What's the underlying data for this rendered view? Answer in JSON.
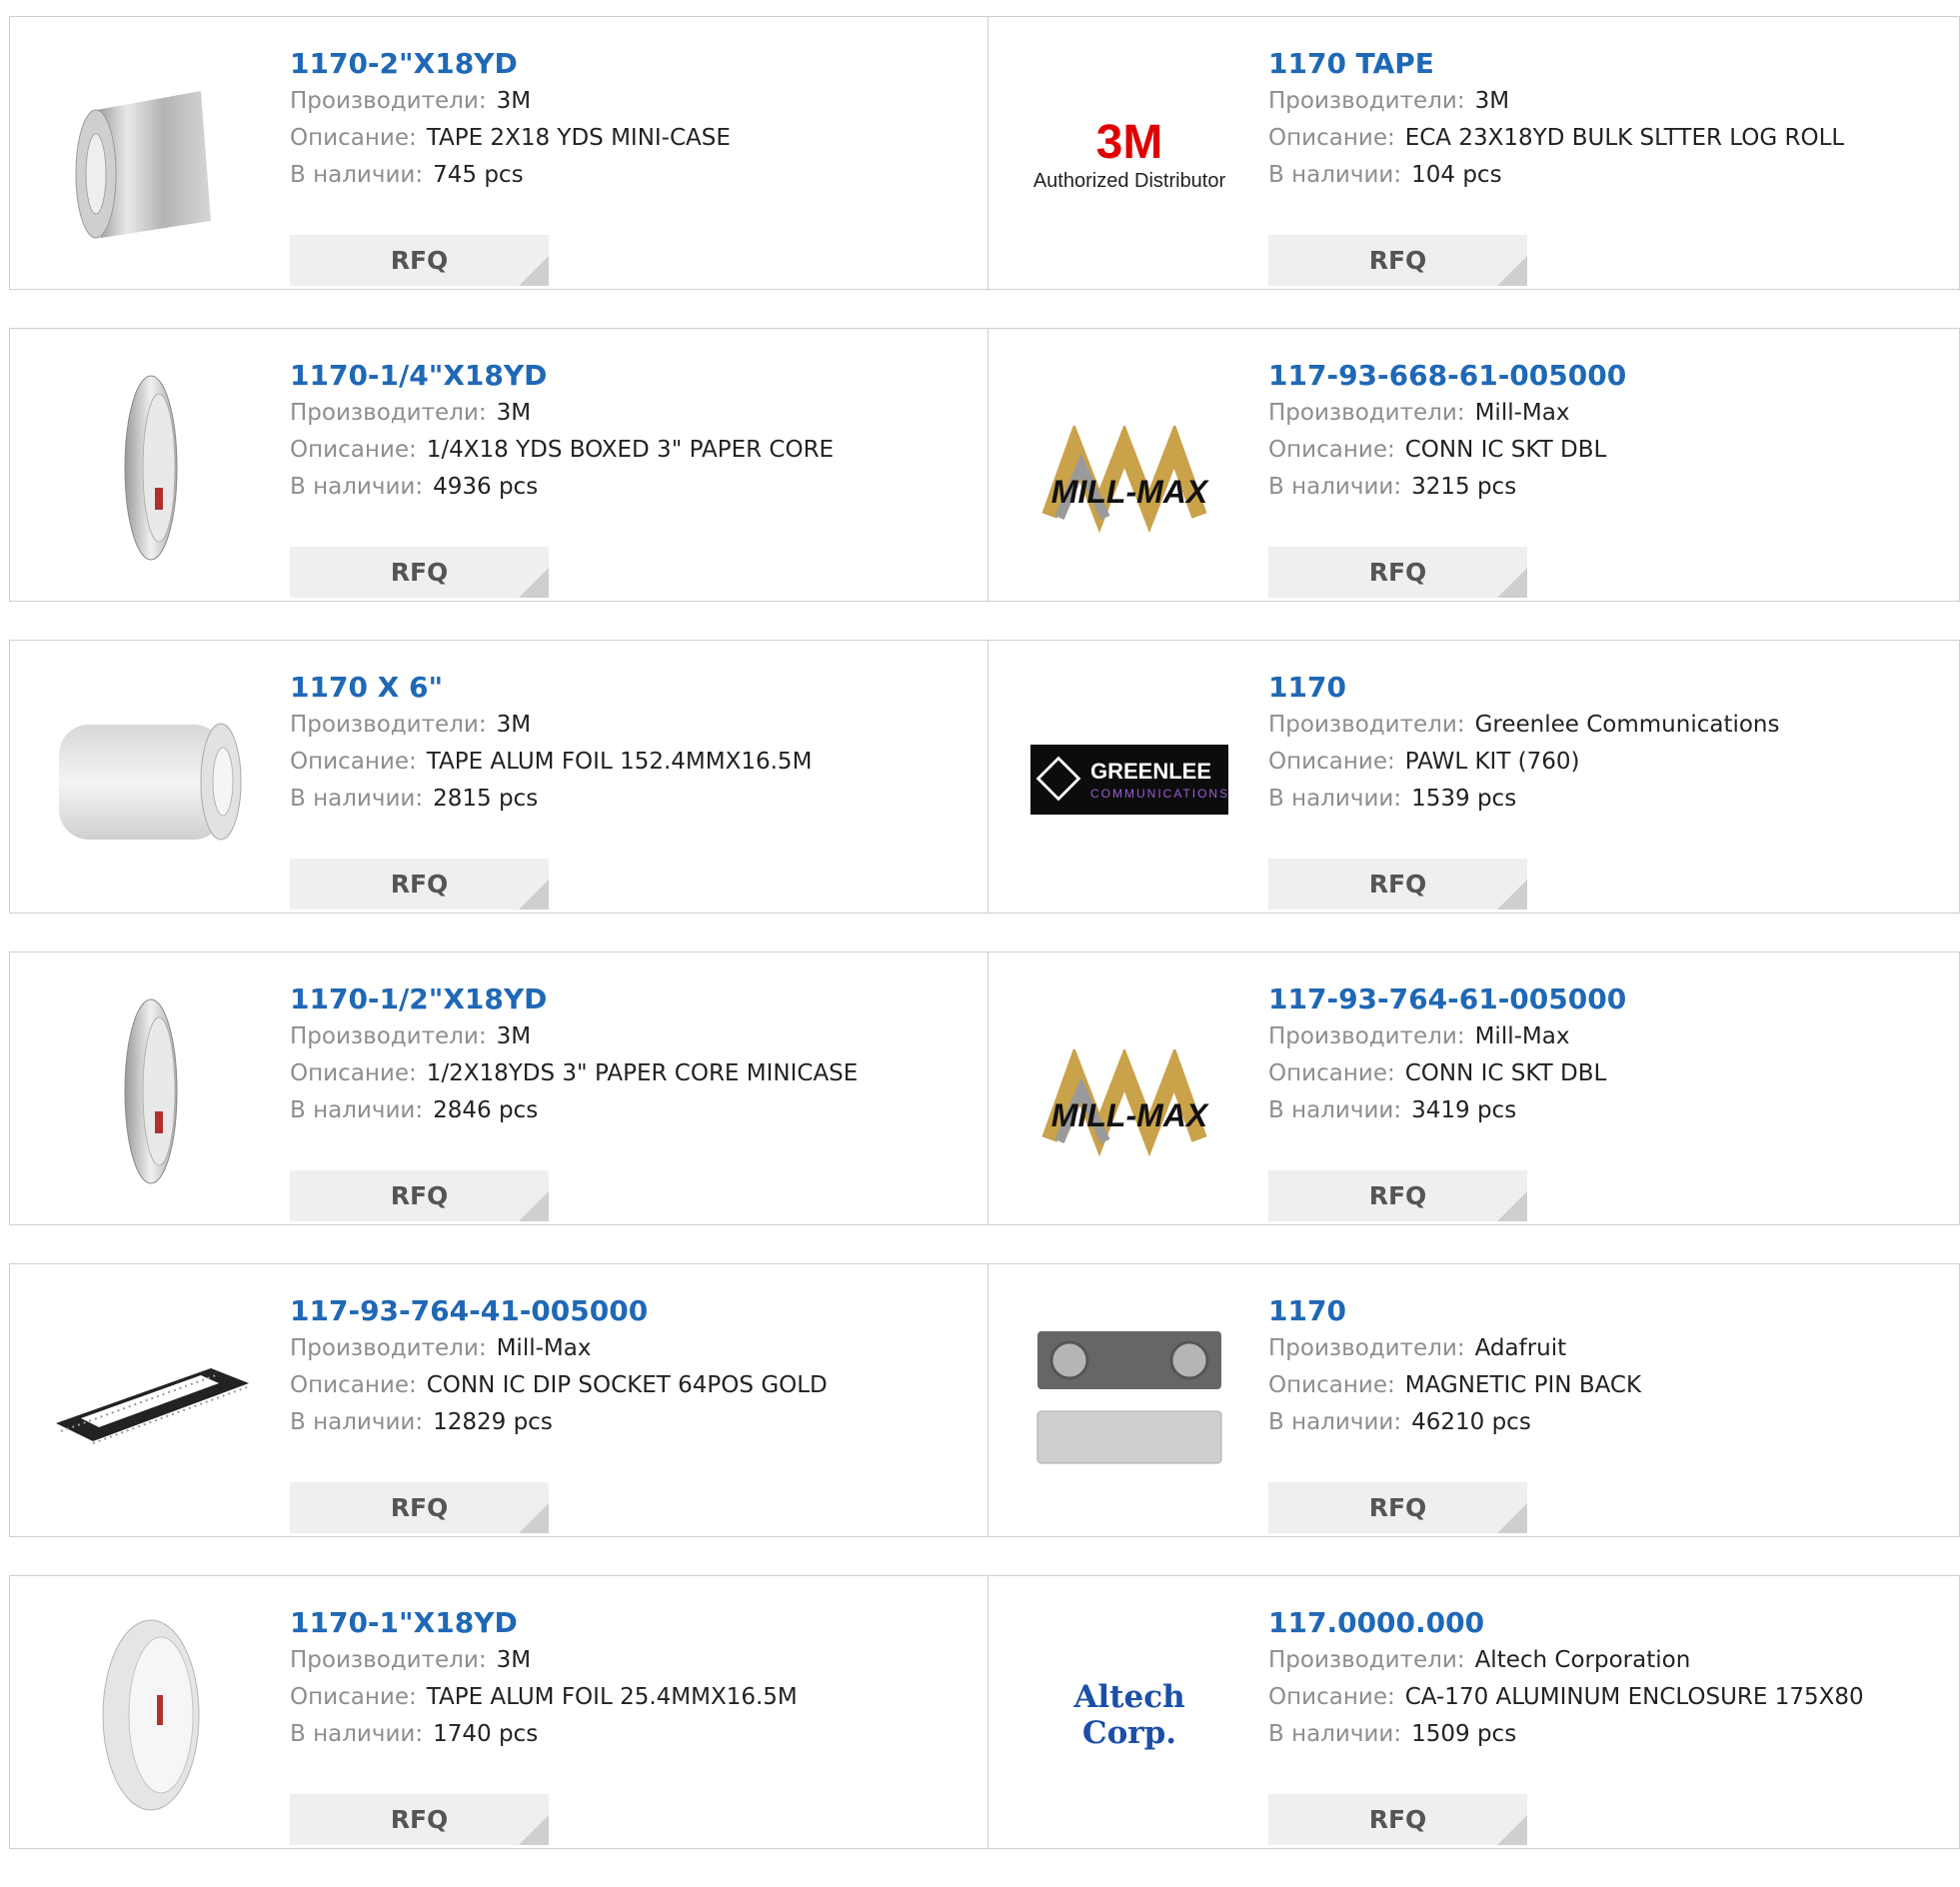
{
  "labels": {
    "manufacturer": "Производители:",
    "description": "Описание:",
    "stock": "В наличии:",
    "rfq": "RFQ"
  },
  "logos": {
    "brand_3m": "3M",
    "brand_3m_sub": "Authorized Distributor",
    "millmax": "MILL-MAX",
    "greenlee": "GREENLEE",
    "greenlee_sub": "COMMUNICATIONS",
    "altech": "Altech Corp."
  },
  "products": [
    {
      "title": "1170-2\"X18YD",
      "manufacturer": "3M",
      "description": "TAPE 2X18 YDS MINI-CASE",
      "stock": "745 pcs",
      "image": "aluminum-tape-roll-icon"
    },
    {
      "title": "1170 TAPE",
      "manufacturer": "3M",
      "description": "ECA 23X18YD BULK SLTTER LOG ROLL",
      "stock": "104 pcs",
      "image": "3m-authorized-distributor-logo"
    },
    {
      "title": "1170-1/4\"X18YD",
      "manufacturer": "3M",
      "description": "1/4X18 YDS BOXED 3\" PAPER CORE",
      "stock": "4936 pcs",
      "image": "narrow-tape-roll-icon"
    },
    {
      "title": "117-93-668-61-005000",
      "manufacturer": "Mill-Max",
      "description": "CONN IC SKT DBL",
      "stock": "3215 pcs",
      "image": "mill-max-logo"
    },
    {
      "title": "1170 X 6\"",
      "manufacturer": "3M",
      "description": "TAPE ALUM FOIL 152.4MMX16.5M",
      "stock": "2815 pcs",
      "image": "wide-foil-roll-icon"
    },
    {
      "title": "1170",
      "manufacturer": "Greenlee Communications",
      "description": "PAWL KIT (760)",
      "stock": "1539 pcs",
      "image": "greenlee-logo"
    },
    {
      "title": "1170-1/2\"X18YD",
      "manufacturer": "3M",
      "description": "1/2X18YDS 3\" PAPER CORE MINICASE",
      "stock": "2846 pcs",
      "image": "narrow-tape-roll-icon"
    },
    {
      "title": "117-93-764-61-005000",
      "manufacturer": "Mill-Max",
      "description": "CONN IC SKT DBL",
      "stock": "3419 pcs",
      "image": "mill-max-logo"
    },
    {
      "title": "117-93-764-41-005000",
      "manufacturer": "Mill-Max",
      "description": "CONN IC DIP SOCKET 64POS GOLD",
      "stock": "12829 pcs",
      "image": "dip-socket-icon"
    },
    {
      "title": "1170",
      "manufacturer": "Adafruit",
      "description": "MAGNETIC PIN BACK",
      "stock": "46210 pcs",
      "image": "magnetic-pin-back-icon"
    },
    {
      "title": "1170-1\"X18YD",
      "manufacturer": "3M",
      "description": "TAPE ALUM FOIL 25.4MMX16.5M",
      "stock": "1740 pcs",
      "image": "white-tape-roll-icon"
    },
    {
      "title": "117.0000.000",
      "manufacturer": "Altech Corporation",
      "description": "CA-170 ALUMINUM ENCLOSURE 175X80",
      "stock": "1509 pcs",
      "image": "altech-corp-logo"
    }
  ]
}
